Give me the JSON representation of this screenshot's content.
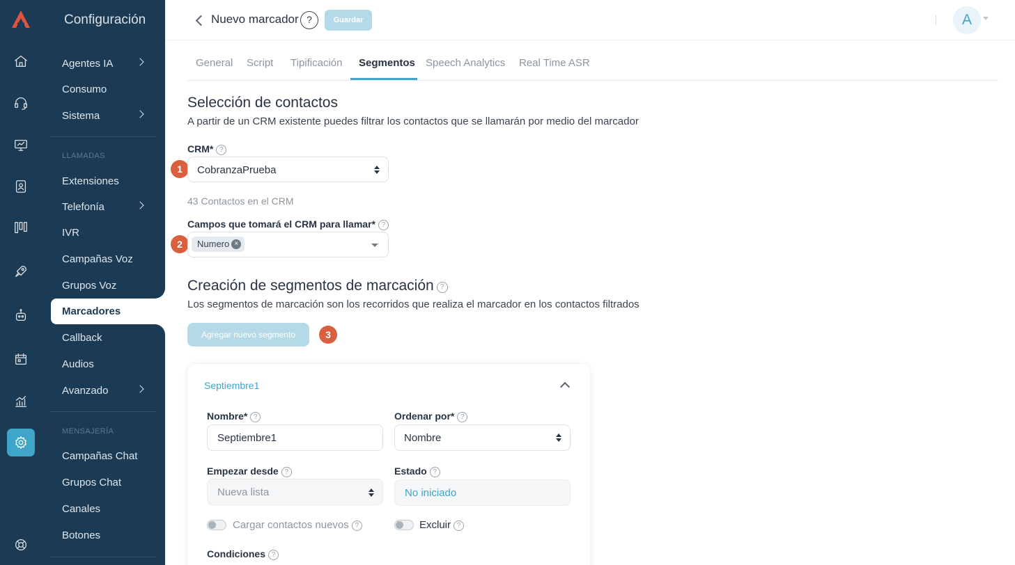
{
  "brand": {
    "accent": "#3fa6c9",
    "sidebar_bg": "#1b3a53",
    "logo_color": "#e0533d",
    "badge_color": "#d9603e"
  },
  "rail_icons": [
    "logo-icon",
    "home-icon",
    "headset-icon",
    "monitor-icon",
    "contacts-icon",
    "kanban-icon",
    "rocket-icon",
    "robot-icon",
    "calendar-icon",
    "analytics-icon",
    "settings-icon",
    "support-icon"
  ],
  "menu": {
    "title": "Configuración",
    "items_top": [
      "Agentes IA",
      "Consumo",
      "Sistema"
    ],
    "section_calls": "LLAMADAS",
    "items_calls": [
      "Extensiones",
      "Telefonía",
      "IVR",
      "Campañas Voz",
      "Grupos Voz",
      "Marcadores",
      "Callback",
      "Audios",
      "Avanzado"
    ],
    "section_msg": "MENSAJERÍA",
    "items_msg": [
      "Campañas Chat",
      "Grupos Chat",
      "Canales",
      "Botones"
    ]
  },
  "header": {
    "title": "Nuevo marcador",
    "help": "?",
    "save": "Guardar",
    "avatar": "A"
  },
  "tabs": [
    "General",
    "Script",
    "Tipificación",
    "Segmentos",
    "Speech Analytics",
    "Real Time ASR"
  ],
  "contacts": {
    "title": "Selección de contactos",
    "subtitle": "A partir de un CRM existente puedes filtrar los contactos que se llamarán por medio del marcador",
    "crm_label": "CRM*",
    "crm_value": "CobranzaPrueba",
    "count": "43 Contactos en el CRM",
    "fields_label": "Campos que tomará el CRM para llamar*",
    "field_chip": "Numero"
  },
  "segments": {
    "title": "Creación de segmentos de marcación",
    "subtitle": "Los segmentos de marcación son los recorridos que realiza el marcador en los contactos filtrados",
    "add_button": "Agregar nuevo segmento",
    "card": {
      "title": "Septiembre1",
      "name_label": "Nombre*",
      "name_value": "Septiembre1",
      "order_label": "Ordenar por*",
      "order_value": "Nombre",
      "start_label": "Empezar desde",
      "start_value": "Nueva lista",
      "state_label": "Estado",
      "state_value": "No iniciado",
      "load_new_label": "Cargar contactos nuevos",
      "exclude_label": "Excluir",
      "conditions_label": "Condiciones"
    }
  },
  "badges": [
    "1",
    "2",
    "3"
  ],
  "help_mark": "?",
  "chip_remove": "×"
}
